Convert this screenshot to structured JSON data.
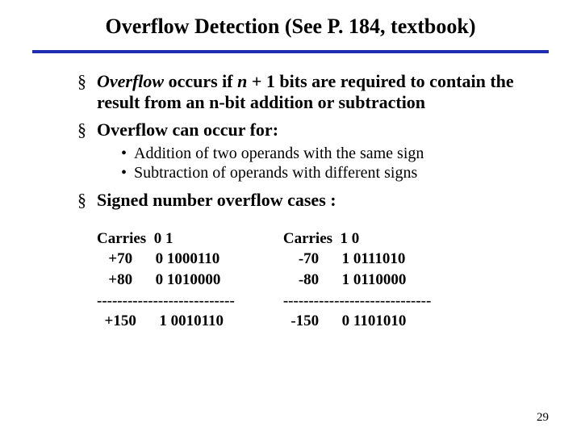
{
  "title": "Overflow Detection (See P. 184, textbook)",
  "bullets": {
    "b1_prefix_italic": "Overflow",
    "b1_rest_a": " occurs if ",
    "b1_n": "n",
    "b1_rest_b": " + 1 bits are required to contain the result from an n-bit addition or subtraction",
    "b2": "Overflow can occur for:",
    "b2_sub1": "Addition of two operands with the same sign",
    "b2_sub2": "Subtraction of operands with different signs",
    "b3": "Signed number overflow cases :"
  },
  "examples": {
    "left": {
      "l1": "Carries  0 1",
      "l2": "   +70      0 1000110",
      "l3": "   +80      0 1010000",
      "sep": "---------------------------",
      "l4": "  +150      1 0010110"
    },
    "right": {
      "l1": "Carries  1 0",
      "l2": "    -70      1 0111010",
      "l3": "    -80      1 0110000",
      "sep": "-----------------------------",
      "l4": "  -150      0 1101010"
    }
  },
  "page_number": "29"
}
